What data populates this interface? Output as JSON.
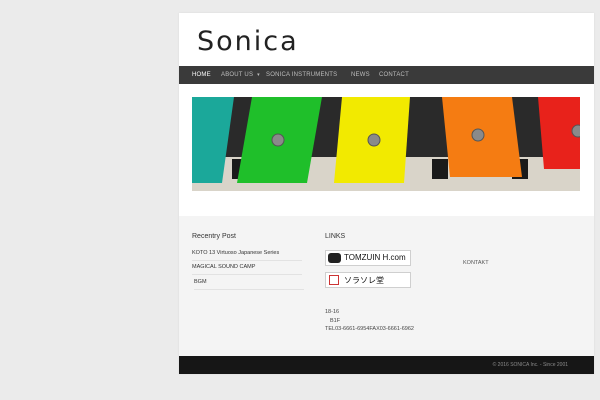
{
  "site": {
    "logo_text": "Sonica"
  },
  "nav": {
    "items": [
      {
        "label": "HOME",
        "active": true
      },
      {
        "label": "ABOUT US",
        "has_submenu": true
      },
      {
        "label": "SONICA INSTRUMENTS"
      },
      {
        "label": "NEWS"
      },
      {
        "label": "CONTACT"
      }
    ],
    "submenu_icon": "chevron-down-icon"
  },
  "banner": {
    "bars": [
      {
        "color": "#1ba89a"
      },
      {
        "color": "#1fbf2a"
      },
      {
        "color": "#f2ea00"
      },
      {
        "color": "#f57c12"
      },
      {
        "color": "#e8221b"
      }
    ]
  },
  "recent": {
    "title": "Recentry Post",
    "posts": [
      "KOTO 13 Virtuoso Japanese Series",
      "MAGICAL SOUND CAMP",
      "BGM"
    ]
  },
  "links": {
    "title": "LINKS",
    "badges": [
      {
        "label": "TOMZUIN H.com",
        "icon": "tomzuin-logo-icon"
      },
      {
        "label": "ソラソレ堂",
        "icon": "pen-logo-icon"
      }
    ]
  },
  "address": {
    "line1": "18-16",
    "line2": "B1F",
    "line3": "TEL03-6661-6954FAX03-6661-6962"
  },
  "kontakt": "KONTAKT",
  "footer": {
    "copyright": "© 2016 SONICA Inc. - Since 2001"
  }
}
